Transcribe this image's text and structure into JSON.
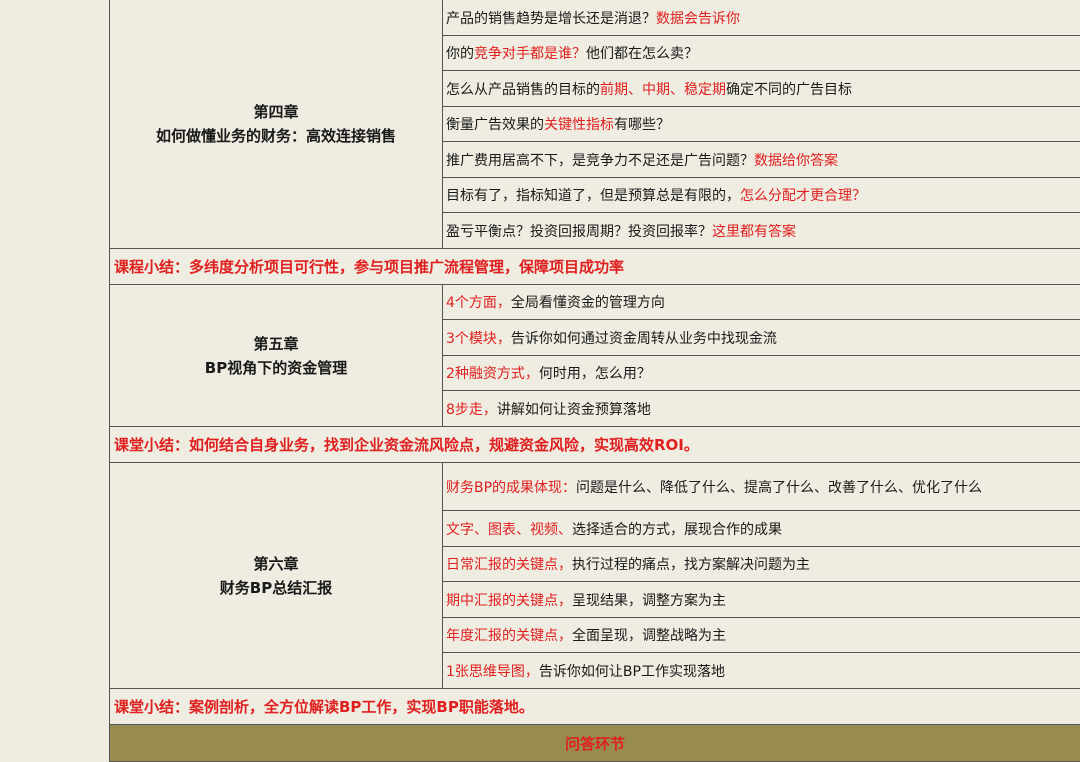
{
  "ch4": {
    "chapter": "第四章",
    "title": "如何做懂业务的财务：高效连接销售",
    "items": [
      {
        "plain1": "产品的销售趋势是增长还是消退？",
        "red1": "数据会告诉你",
        "plain2": "",
        "red2": ""
      },
      {
        "plain1": "你的",
        "red1": "竞争对手都是谁？",
        "plain2": "他们都在怎么卖？",
        "red2": ""
      },
      {
        "plain1": "怎么从产品销售的目标的",
        "red1": "前期、中期、稳定期",
        "plain2": "确定不同的广告目标",
        "red2": ""
      },
      {
        "plain1": "衡量广告效果的",
        "red1": "关键性指标",
        "plain2": "有哪些？",
        "red2": ""
      },
      {
        "plain1": "推广费用居高不下，是竞争力不足还是广告问题？",
        "red1": "数据给你答案",
        "plain2": "",
        "red2": ""
      },
      {
        "plain1": "目标有了，指标知道了，但是预算总是有限的，",
        "red1": "怎么分配才更合理？",
        "plain2": "",
        "red2": ""
      },
      {
        "plain1": "盈亏平衡点？投资回报周期？投资回报率？",
        "red1": "这里都有答案",
        "plain2": "",
        "red2": ""
      }
    ],
    "summary": "课程小结：多纬度分析项目可行性，参与项目推广流程管理，保障项目成功率"
  },
  "ch5": {
    "chapter": "第五章",
    "title": "BP视角下的资金管理",
    "items": [
      {
        "red": "4个方面，",
        "plain": "全局看懂资金的管理方向"
      },
      {
        "red": "3个模块，",
        "plain": "告诉你如何通过资金周转从业务中找现金流"
      },
      {
        "red": "2种融资方式，",
        "plain": "何时用，怎么用？"
      },
      {
        "red": "8步走，",
        "plain": "讲解如何让资金预算落地"
      }
    ],
    "summary": "课堂小结：如何结合自身业务，找到企业资金流风险点，规避资金风险，实现高效ROI。"
  },
  "ch6": {
    "chapter": "第六章",
    "title": "财务BP总结汇报",
    "items": [
      {
        "red": "财务BP的成果体现：",
        "plain": "问题是什么、降低了什么、提高了什么、改善了什么、优化了什么"
      },
      {
        "red": "文字、图表、视频、",
        "plain": "选择适合的方式，展现合作的成果"
      },
      {
        "red": "日常汇报的关键点，",
        "plain": "执行过程的痛点，找方案解决问题为主"
      },
      {
        "red": "期中汇报的关键点，",
        "plain": "呈现结果，调整方案为主"
      },
      {
        "red": "年度汇报的关键点，",
        "plain": "全面呈现，调整战略为主"
      },
      {
        "red": "1张思维导图，",
        "plain": "告诉你如何让BP工作实现落地"
      }
    ],
    "summary": "课堂小结：案例剖析，全方位解读BP工作，实现BP职能落地。"
  },
  "qa": "问答环节"
}
